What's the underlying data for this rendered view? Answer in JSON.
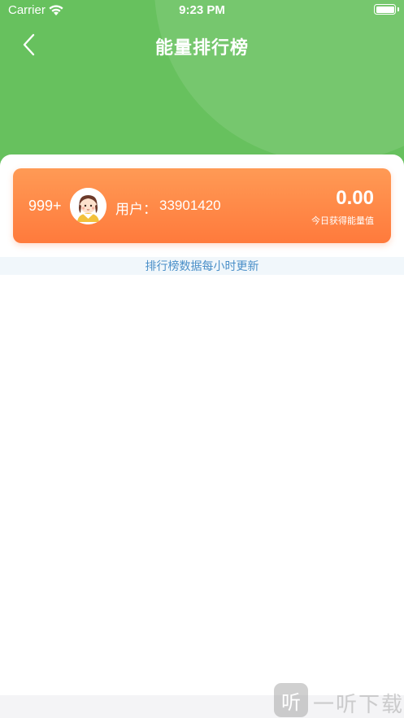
{
  "status_bar": {
    "carrier": "Carrier",
    "time": "9:23 PM",
    "wifi_icon": "wifi-icon",
    "battery_icon": "battery-icon"
  },
  "nav": {
    "title": "能量排行榜",
    "back_icon": "chevron-left-icon"
  },
  "my_rank": {
    "rank": "999+",
    "user_label": "用户：",
    "user_id": "33901420",
    "energy_value": "0.00",
    "energy_caption": "今日获得能量值",
    "avatar_icon": "avatar-girl-icon"
  },
  "notice": {
    "text": "排行榜数据每小时更新"
  },
  "watermark": {
    "logo_glyph": "听",
    "text": "一听下载"
  },
  "colors": {
    "header_green": "#67c15e",
    "card_orange_top": "#ff9a55",
    "card_orange_bottom": "#ff7a3c",
    "notice_text": "#4a8fc8",
    "notice_bg": "#f1f7fb"
  }
}
